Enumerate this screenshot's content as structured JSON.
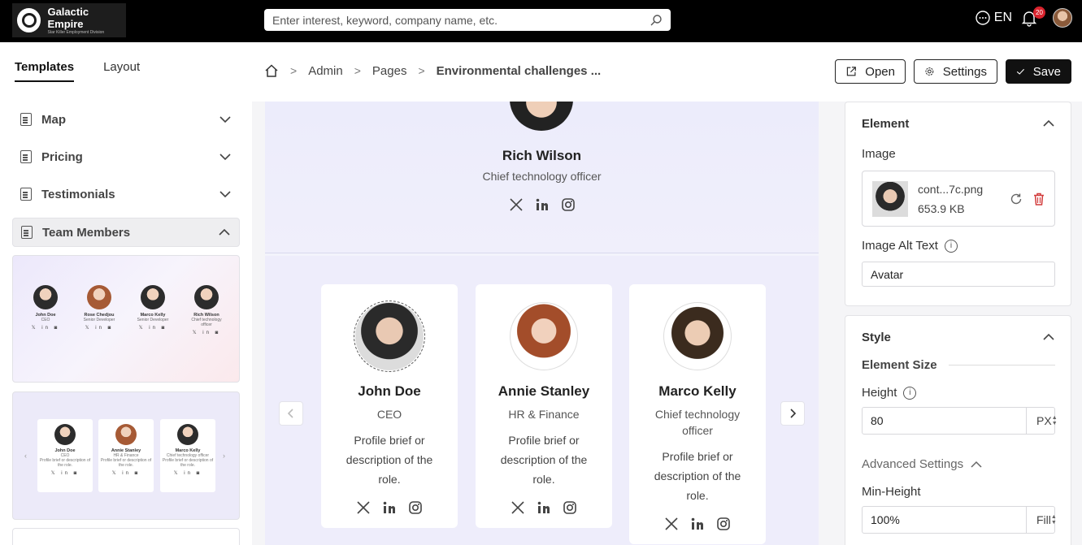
{
  "brand": {
    "name": "Galactic Empire",
    "tagline": "Star Killer Employment Division"
  },
  "search": {
    "placeholder": "Enter interest, keyword, company name, etc."
  },
  "topbar": {
    "language": "EN",
    "notifications": "20"
  },
  "left_tabs": [
    {
      "label": "Templates",
      "active": true
    },
    {
      "label": "Layout",
      "active": false
    }
  ],
  "sections": [
    {
      "label": "Map"
    },
    {
      "label": "Pricing"
    },
    {
      "label": "Testimonials"
    },
    {
      "label": "Team Members"
    }
  ],
  "thumb1": {
    "members": [
      {
        "name": "John Doe",
        "role": "CEO"
      },
      {
        "name": "Rose Chedjou",
        "role": "Senior Developer"
      },
      {
        "name": "Marco Kelly",
        "role": "Senior Developer"
      },
      {
        "name": "Rich Wilson",
        "role": "Chief technology officer"
      }
    ],
    "social": "𝕏 in ◙"
  },
  "thumb2": {
    "members": [
      {
        "name": "John Doe",
        "role": "CEO",
        "desc": "Profile brief or description of the role."
      },
      {
        "name": "Annie Stanley",
        "role": "HR & Finance",
        "desc": "Profile brief or description of the role."
      },
      {
        "name": "Marco Kelly",
        "role": "Chief technology officer",
        "desc": "Profile brief or description of the role."
      }
    ],
    "prev": "‹",
    "next": "›"
  },
  "breadcrumb": {
    "items": [
      "Admin",
      "Pages"
    ],
    "current": "Environmental challenges ..."
  },
  "actions": {
    "open": "Open",
    "settings": "Settings",
    "save": "Save"
  },
  "hero": {
    "name": "Rich Wilson",
    "role": "Chief technology officer"
  },
  "cards": [
    {
      "name": "John Doe",
      "role": "CEO",
      "desc": "Profile brief or description of the role."
    },
    {
      "name": "Annie Stanley",
      "role": "HR & Finance",
      "desc": "Profile brief or description of the role."
    },
    {
      "name": "Marco Kelly",
      "role": "Chief technology officer",
      "desc": "Profile brief or description of the role."
    }
  ],
  "element_panel": {
    "title": "Element",
    "image_label": "Image",
    "file_name": "cont...7c.png",
    "file_size": "653.9 KB",
    "alt_label": "Image Alt Text",
    "alt_value": "Avatar"
  },
  "style_panel": {
    "title": "Style",
    "size_title": "Element Size",
    "height_label": "Height",
    "height_value": "80",
    "height_unit": "PX",
    "advanced_label": "Advanced Settings",
    "min_height_label": "Min-Height",
    "min_height_value": "100%",
    "min_height_unit": "Fill"
  },
  "colors": {
    "topbar": "#000000",
    "accent": "#111111",
    "badge": "#d9232d",
    "canvas": "#eeedfb"
  }
}
